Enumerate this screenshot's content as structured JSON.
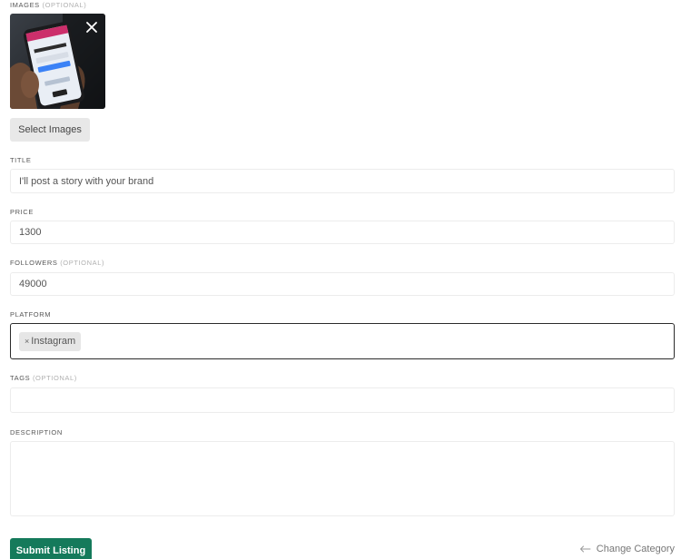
{
  "images": {
    "label": "IMAGES",
    "optional": "(OPTIONAL)",
    "select_button": "Select Images",
    "remove_icon": "close-icon"
  },
  "title": {
    "label": "TITLE",
    "value": "I'll post a story with your brand"
  },
  "price": {
    "label": "PRICE",
    "value": "1300"
  },
  "followers": {
    "label": "FOLLOWERS",
    "optional": "(OPTIONAL)",
    "value": "49000"
  },
  "platform": {
    "label": "PLATFORM",
    "selected": [
      {
        "remove": "×",
        "label": "Instagram"
      }
    ]
  },
  "tags": {
    "label": "TAGS",
    "optional": "(OPTIONAL)",
    "value": ""
  },
  "description": {
    "label": "DESCRIPTION",
    "value": ""
  },
  "actions": {
    "submit": "Submit Listing",
    "change_category": "Change Category"
  },
  "colors": {
    "submit_bg": "#157a5b",
    "focus_border": "#2b2b2b"
  }
}
